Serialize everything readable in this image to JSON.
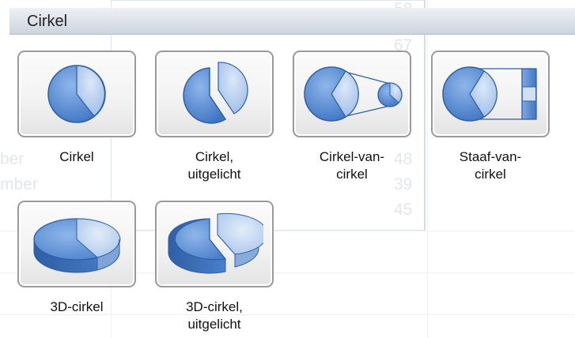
{
  "section_title": "Cirkel",
  "charts": [
    {
      "label": "Cirkel",
      "icon": "pie-chart-icon"
    },
    {
      "label": "Cirkel,\nuitgelicht",
      "icon": "exploded-pie-chart-icon"
    },
    {
      "label": "Cirkel-van-\ncirkel",
      "icon": "pie-of-pie-chart-icon"
    },
    {
      "label": "Staaf-van-\ncirkel",
      "icon": "bar-of-pie-chart-icon"
    },
    {
      "label": "3D-cirkel",
      "icon": "3d-pie-chart-icon"
    },
    {
      "label": "3D-cirkel,\nuitgelicht",
      "icon": "3d-exploded-pie-chart-icon"
    }
  ],
  "background_ghost": {
    "numbers": [
      "58",
      "67",
      "48",
      "39",
      "45"
    ],
    "words": [
      "ber",
      "mber"
    ]
  },
  "colors": {
    "pie_main": "#5b8fd6",
    "pie_light": "#b5cdf0",
    "pie_stroke": "#2d5fa8"
  }
}
